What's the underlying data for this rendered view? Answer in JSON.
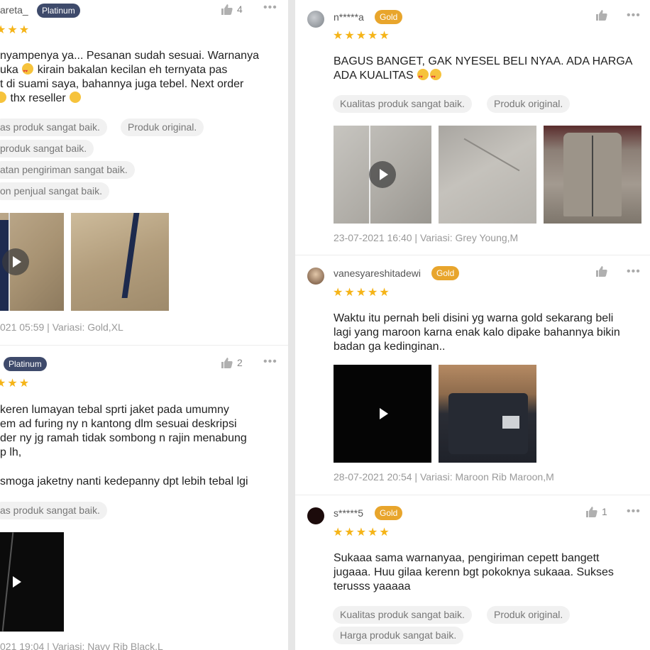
{
  "colors": {
    "star": "#f5b418",
    "gold_badge": "#e8a52c",
    "platinum_badge": "#3e4a6b",
    "tag_bg": "#f1f1f1"
  },
  "left": {
    "review1": {
      "username": "areta_",
      "badge": "Platinum",
      "likes": "4",
      "text": [
        "nyampenya ya... Pesanan sudah sesuai. Warnanya",
        [
          "uka ",
          " kirain bakalan kecilan eh ternyata pas"
        ],
        "t di suami saya, bahannya juga tebel. Next order",
        " thx reseller "
      ],
      "tags": [
        "as produk sangat baik.",
        "Produk original.",
        " produk sangat baik.",
        "atan pengiriman sangat baik.",
        "on penjual sangat baik."
      ],
      "meta": "021 05:59 | Variasi: Gold,XL"
    },
    "review2": {
      "badge": "Platinum",
      "likes": "2",
      "text": [
        "keren lumayan tebal sprti jaket pada umumny",
        "em ad furing ny n kantong dlm sesuai deskripsi",
        "der ny jg ramah tidak sombong n rajin menabung",
        "p lh,",
        "smoga jaketny nanti kedepanny dpt lebih tebal lgi"
      ],
      "tags": [
        "as produk sangat baik."
      ],
      "meta": "021 19:04 | Variasi: Navy Rib  Black,L"
    }
  },
  "right": {
    "review1": {
      "username": "n*****a",
      "badge": "Gold",
      "text": [
        "BAGUS BANGET, GAK NYESEL BELI NYAA. ADA HARGA",
        "ADA KUALITAS "
      ],
      "tags": [
        "Kualitas produk sangat baik.",
        "Produk original."
      ],
      "meta": "23-07-2021 16:40 | Variasi: Grey Young,M"
    },
    "review2": {
      "username": "vanesyareshitadewi",
      "badge": "Gold",
      "text": [
        "Waktu itu pernah beli disini yg warna gold sekarang beli",
        "lagi yang maroon karna enak kalo dipake bahannya bikin",
        "badan ga kedinginan.."
      ],
      "meta": "28-07-2021 20:54 | Variasi: Maroon  Rib Maroon,M"
    },
    "review3": {
      "username": "s*****5",
      "badge": "Gold",
      "likes": "1",
      "text": [
        "Sukaaa sama warnanyaa, pengiriman cepett bangett",
        "jugaaa. Huu gilaa kerenn bgt pokoknya sukaaa. Sukses",
        "terusss yaaaaa"
      ],
      "tags": [
        "Kualitas produk sangat baik.",
        "Produk original.",
        "Harga produk sangat baik."
      ]
    }
  },
  "icons": {
    "like": "thumbs-up-icon",
    "more": "more-dots-icon",
    "play": "play-icon",
    "star": "star-icon"
  },
  "glyphs": {
    "more": "•••",
    "star": "★"
  }
}
